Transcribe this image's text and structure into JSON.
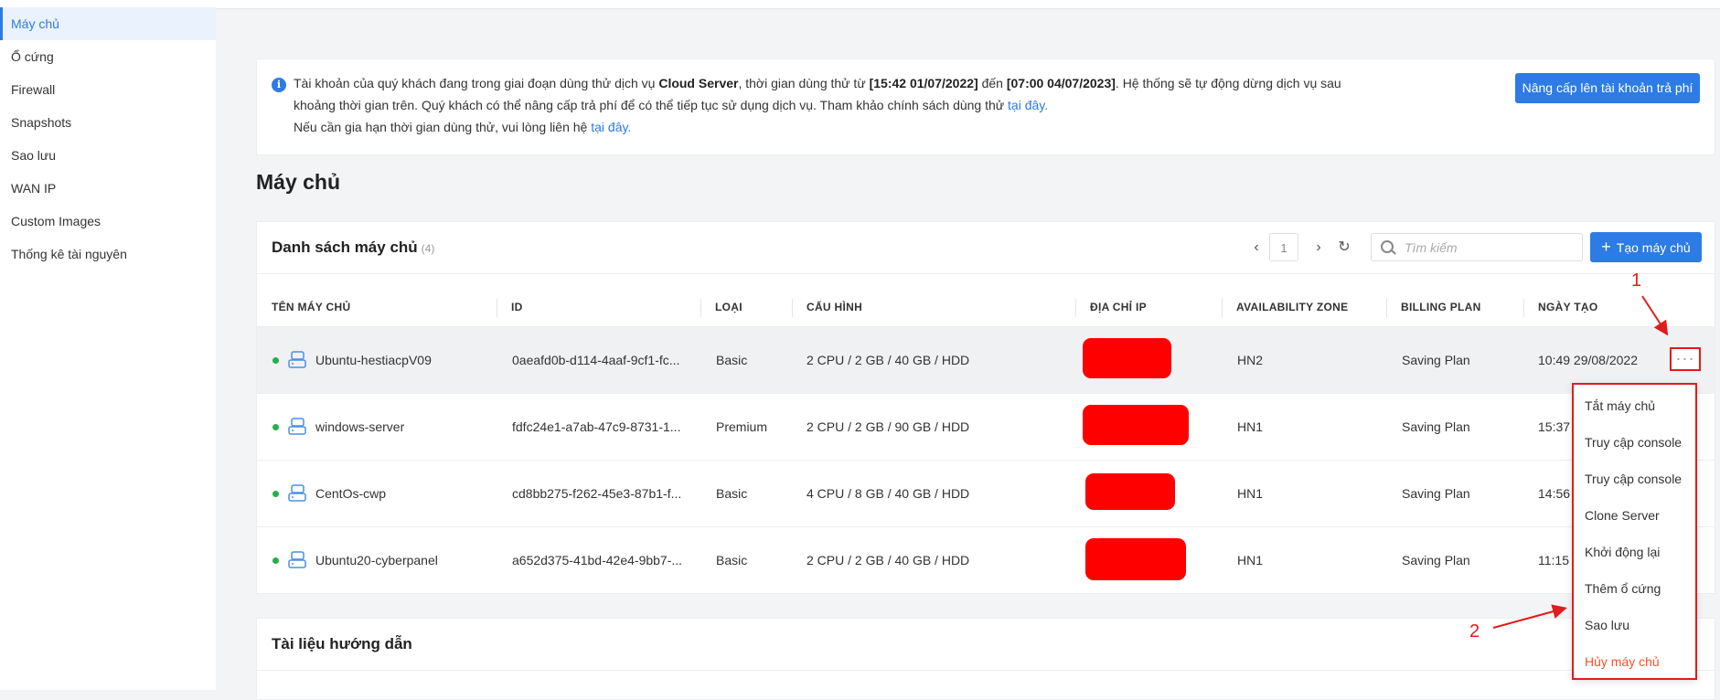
{
  "sidebar": {
    "items": [
      {
        "label": "Máy chủ",
        "active": true
      },
      {
        "label": "Ổ cứng"
      },
      {
        "label": "Firewall"
      },
      {
        "label": "Snapshots"
      },
      {
        "label": "Sao lưu"
      },
      {
        "label": "WAN IP"
      },
      {
        "label": "Custom Images"
      },
      {
        "label": "Thống kê tài nguyên"
      }
    ]
  },
  "notice": {
    "line1_pre": "Tài khoản của quý khách đang trong giai đoạn dùng thử dịch vụ ",
    "service": "Cloud Server",
    "line1_mid": ", thời gian dùng thử từ ",
    "start": "[15:42 01/07/2022]",
    "line1_to": " đến ",
    "end": "[07:00 04/07/2023]",
    "line1_post": ". Hệ thống sẽ tự động dừng dịch vụ sau",
    "line2": "khoảng thời gian trên. Quý khách có thể nâng cấp trả phí để có thể tiếp tục sử dụng dịch vụ. Tham khảo chính sách dùng thử ",
    "link1": "tại đây.",
    "line3": "Nếu cần gia hạn thời gian dùng thử, vui lòng liên hệ ",
    "link2": "tại đây.",
    "upgrade_button": "Nâng cấp lên tài khoản trả phí"
  },
  "page_title": "Máy chủ",
  "servers_card": {
    "title": "Danh sách máy chủ",
    "count": "(4)",
    "page": "1",
    "search_placeholder": "Tìm kiếm",
    "create_button": "Tạo máy chủ",
    "columns": [
      "TÊN MÁY CHỦ",
      "ID",
      "LOẠI",
      "CẤU HÌNH",
      "ĐỊA CHỈ IP",
      "AVAILABILITY ZONE",
      "BILLING PLAN",
      "NGÀY TẠO"
    ],
    "rows": [
      {
        "name": "Ubuntu-hestiacpV09",
        "id": "0aeafd0b-d114-4aaf-9cf1-fc...",
        "type": "Basic",
        "config": "2 CPU / 2 GB / 40 GB / HDD",
        "zone": "HN2",
        "plan": "Saving Plan",
        "created": "10:49 29/08/2022",
        "status_color": "#22b04b"
      },
      {
        "name": "windows-server",
        "id": "fdfc24e1-a7ab-47c9-8731-1...",
        "type": "Premium",
        "config": "2 CPU / 2 GB / 90 GB / HDD",
        "zone": "HN1",
        "plan": "Saving Plan",
        "created": "15:37",
        "status_color": "#22b04b"
      },
      {
        "name": "CentOs-cwp",
        "id": "cd8bb275-f262-45e3-87b1-f...",
        "type": "Basic",
        "config": "4 CPU / 8 GB / 40 GB / HDD",
        "zone": "HN1",
        "plan": "Saving Plan",
        "created": "14:56",
        "status_color": "#22b04b"
      },
      {
        "name": "Ubuntu20-cyberpanel",
        "id": "a652d375-41bd-42e4-9bb7-...",
        "type": "Basic",
        "config": "2 CPU / 2 GB / 40 GB / HDD",
        "zone": "HN1",
        "plan": "Saving Plan",
        "created": "11:15",
        "status_color": "#22b04b"
      }
    ]
  },
  "docs_card": {
    "title": "Tài liệu hướng dẫn"
  },
  "context_menu": {
    "items": [
      "Tắt máy chủ",
      "Truy cập console",
      "Truy cập console",
      "Clone Server",
      "Khởi động lại",
      "Thêm ổ cứng",
      "Sao lưu",
      "Hủy máy chủ"
    ]
  },
  "annotations": {
    "marker1": "1",
    "marker2": "2",
    "color": "#e21b1b"
  },
  "colors": {
    "primary": "#2d7be5",
    "danger": "#f5512b",
    "status_ok": "#22b04b",
    "redaction": "#ff0000"
  }
}
